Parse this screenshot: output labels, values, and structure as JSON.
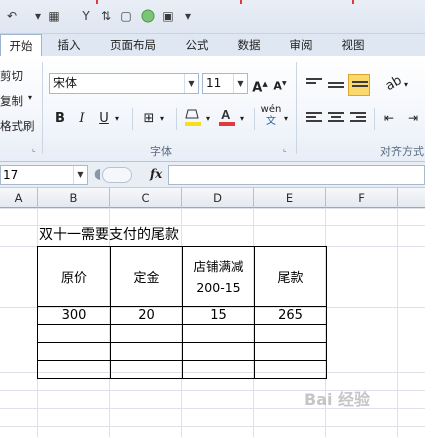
{
  "tabs": [
    "开始",
    "插入",
    "页面布局",
    "公式",
    "数据",
    "审阅",
    "视图"
  ],
  "clipboard": {
    "cut": "剪切",
    "copy": "复制",
    "format_painter": "格式刷"
  },
  "font": {
    "name": "宋体",
    "size": "11",
    "grow": "A",
    "shrink": "A",
    "bold": "B",
    "italic": "I",
    "underline": "U",
    "group_label": "字体",
    "phonetic": "wén"
  },
  "alignment": {
    "group_label": "对齐方式"
  },
  "formula_bar": {
    "cell_ref": "17",
    "fx": "fx",
    "content": ""
  },
  "columns": [
    "A",
    "B",
    "C",
    "D",
    "E",
    "F"
  ],
  "sheet": {
    "title": "双十一需要支付的尾款",
    "headers": [
      "原价",
      "定金",
      "店铺满减",
      "尾款"
    ],
    "header_line2": "200-15",
    "rows": [
      [
        "300",
        "20",
        "15",
        "265"
      ]
    ]
  },
  "watermark": "Bai 经验",
  "colors": {
    "accent": "#f5c33b",
    "red": "#e0393e",
    "ribbon_tab_bg": "#dfe7f2"
  }
}
